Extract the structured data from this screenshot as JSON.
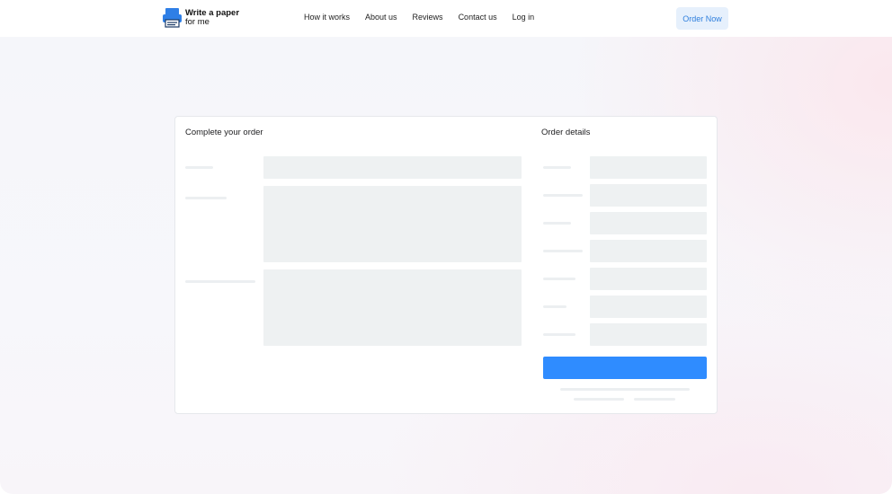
{
  "header": {
    "logo": {
      "line1": "Write a paper",
      "line2": "for me"
    },
    "nav": [
      "How it works",
      "About us",
      "Reviews",
      "Contact us",
      "Log in"
    ],
    "order_button": "Order Now"
  },
  "form": {
    "left_title": "Complete your order",
    "right_title": "Order details"
  },
  "colors": {
    "accent": "#2f8cff",
    "order_button_bg": "#e6f0fc",
    "order_button_text": "#2f7fdd",
    "skeleton": "#eef1f2"
  },
  "icons": {
    "logo": "printer-paper-icon"
  }
}
